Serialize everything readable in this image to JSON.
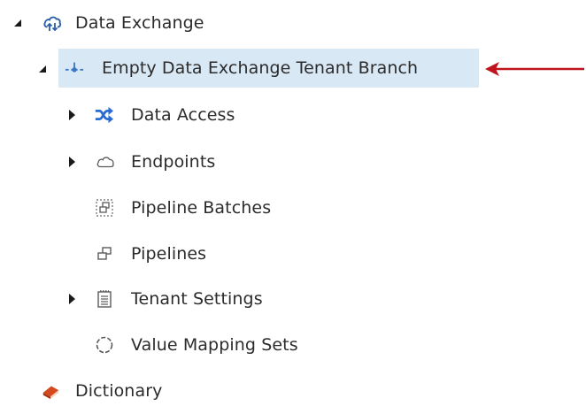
{
  "tree": {
    "root": {
      "label": "Data Exchange",
      "icon": "cloud-exchange-icon",
      "expanded": true
    },
    "branch": {
      "label": "Empty Data Exchange Tenant Branch",
      "icon": "branch-icon",
      "expanded": true,
      "selected": true
    },
    "children": [
      {
        "label": "Data Access",
        "icon": "shuffle-icon",
        "has_children": true
      },
      {
        "label": "Endpoints",
        "icon": "cloud-outline-icon",
        "has_children": true
      },
      {
        "label": "Pipeline Batches",
        "icon": "pipeline-batches-icon",
        "has_children": false
      },
      {
        "label": "Pipelines",
        "icon": "pipelines-icon",
        "has_children": false
      },
      {
        "label": "Tenant Settings",
        "icon": "notepad-icon",
        "has_children": true
      },
      {
        "label": "Value Mapping Sets",
        "icon": "dashed-circle-icon",
        "has_children": false
      }
    ],
    "sibling": {
      "label": "Dictionary",
      "icon": "book-icon"
    }
  },
  "colors": {
    "selection_bg": "#d9e8f5",
    "annotation_arrow": "#c0141c",
    "shuffle_icon": "#2a6bd1",
    "book_icon": "#d24a1e"
  }
}
